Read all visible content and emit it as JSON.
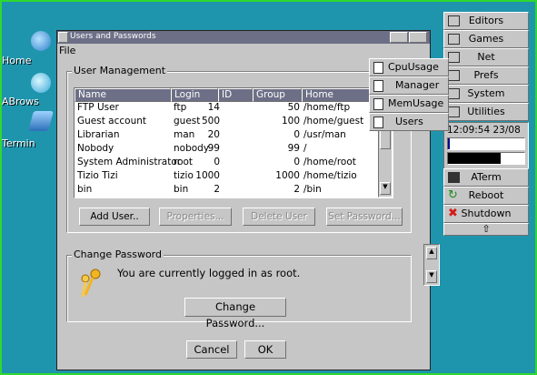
{
  "desktop": {
    "icons": [
      {
        "label": "Home"
      },
      {
        "label": "ABrows"
      },
      {
        "label": "Termin"
      }
    ]
  },
  "window": {
    "title": "Users and Passwords",
    "menu": {
      "file": "File"
    },
    "user_mgmt": {
      "legend": "User Management",
      "columns": [
        "Name",
        "Login",
        "ID",
        "Group",
        "Home"
      ],
      "rows": [
        [
          "FTP User",
          "ftp",
          "14",
          "50",
          "/home/ftp"
        ],
        [
          "Guest account",
          "guest",
          "500",
          "100",
          "/home/guest"
        ],
        [
          "Librarian",
          "man",
          "20",
          "0",
          "/usr/man"
        ],
        [
          "Nobody",
          "nobody",
          "99",
          "99",
          "/"
        ],
        [
          "System Administrator",
          "root",
          "0",
          "0",
          "/home/root"
        ],
        [
          "Tizio Tizi",
          "tizio",
          "1000",
          "1000",
          "/home/tizio"
        ],
        [
          "bin",
          "bin",
          "2",
          "2",
          "/bin"
        ]
      ],
      "buttons": {
        "add": "Add User..",
        "properties": "Properties...",
        "delete": "Delete User",
        "set_password": "Set Password..."
      }
    },
    "change_pw": {
      "legend": "Change Password",
      "message": "You are currently logged in as root.",
      "button": "Change Password..."
    },
    "cancel": "Cancel",
    "ok": "OK"
  },
  "panel": {
    "items": [
      "Editors",
      "Games",
      "Net",
      "Prefs",
      "System",
      "Utilities"
    ],
    "clock": "12:09:54 23/08",
    "aterm": "ATerm",
    "reboot": "Reboot",
    "shutdown": "Shutdown",
    "submenu": [
      "CpuUsage",
      "Manager",
      "MemUsage",
      "Users"
    ]
  }
}
